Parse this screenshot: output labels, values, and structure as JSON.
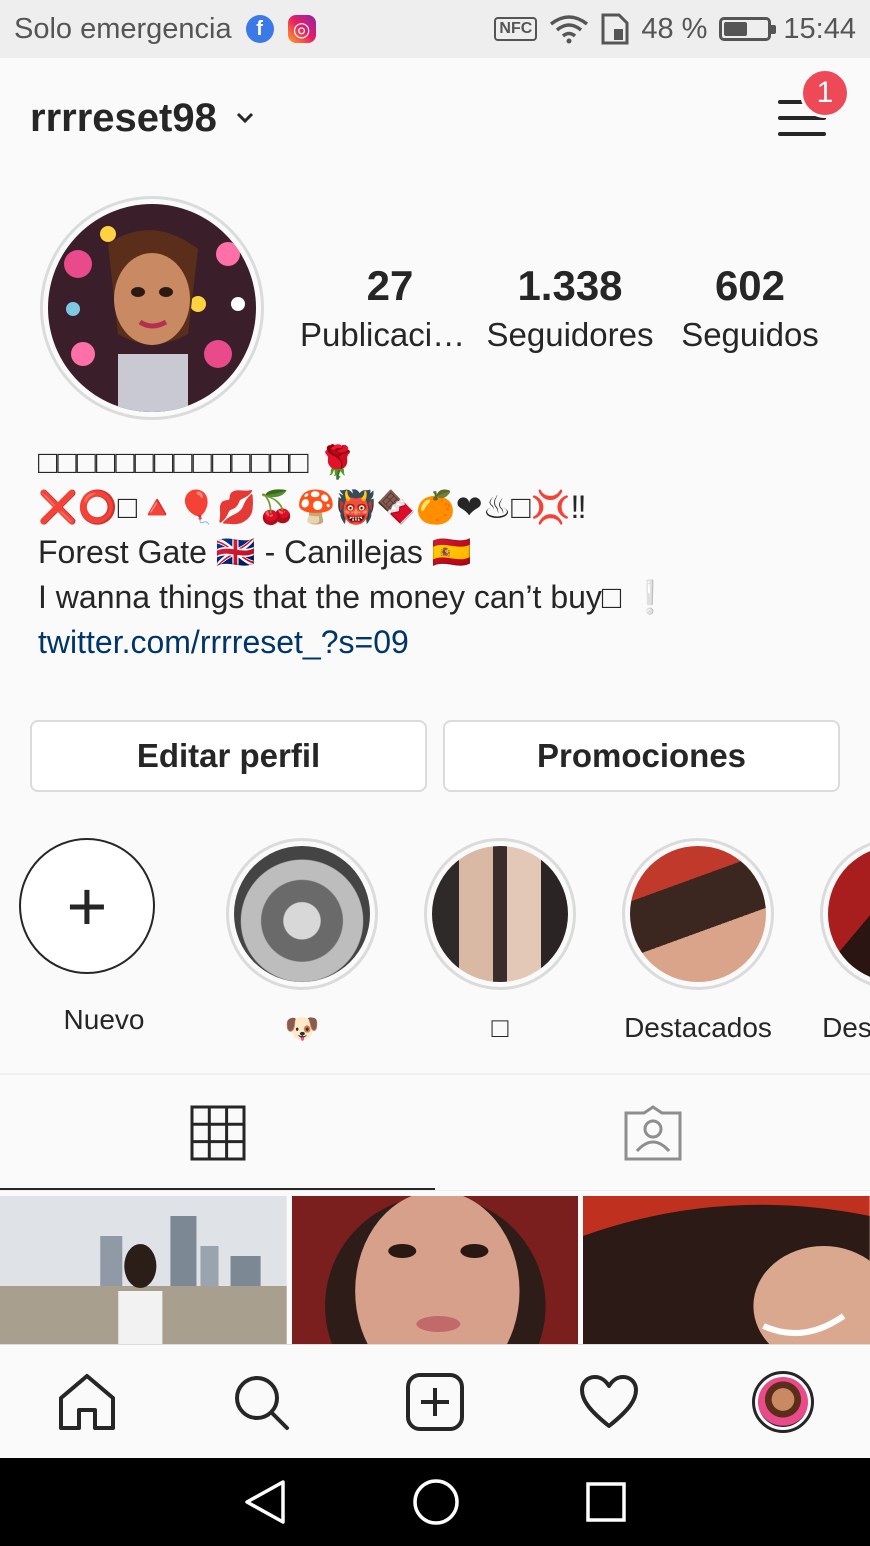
{
  "statusbar": {
    "carrier": "Solo emergencia",
    "apps": [
      "f",
      "◎"
    ],
    "nfc": "NFC",
    "battery_text": "48 %",
    "battery_level": 0.48,
    "time": "15:44"
  },
  "header": {
    "username": "rrrreset98",
    "menu_badge": "1"
  },
  "profile": {
    "stats": [
      {
        "value": "27",
        "label": "Publicaciones"
      },
      {
        "value": "1.338",
        "label": "Seguidores"
      },
      {
        "value": "602",
        "label": "Seguidos"
      }
    ],
    "bio": {
      "line1": "□□□□□□□□□□□□□□ 🌹",
      "line2": "❌⭕□🔺🎈💋🍒🍄👹🍫🍊❤♨□💢‼",
      "line3": "Forest Gate 🇬🇧 - Canillejas 🇪🇸",
      "line4": "I wanna things that the money can’t buy□ ❕",
      "link": "twitter.com/rrrreset_?s=09"
    },
    "buttons": {
      "edit": "Editar perfil",
      "promotions": "Promociones"
    }
  },
  "highlights": [
    {
      "label": "Nuevo",
      "type": "new"
    },
    {
      "label": "🐶",
      "type": "story"
    },
    {
      "label": "□",
      "type": "story"
    },
    {
      "label": "Destacados",
      "type": "story"
    },
    {
      "label": "Destacados",
      "type": "story"
    }
  ],
  "tabs": [
    {
      "icon": "grid-icon",
      "active": true
    },
    {
      "icon": "tagged-icon",
      "active": false
    }
  ],
  "nav": [
    "home-icon",
    "search-icon",
    "new-post-icon",
    "activity-heart-icon",
    "profile-avatar"
  ],
  "colors": {
    "badge": "#ed4956",
    "link": "#003569",
    "text": "#262626",
    "border": "#dbdbdb"
  }
}
